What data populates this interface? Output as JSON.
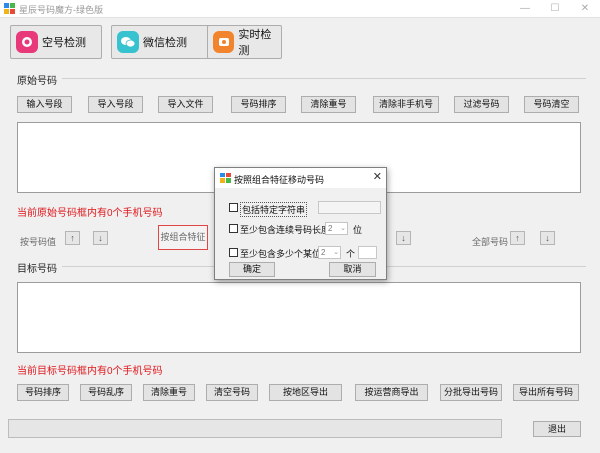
{
  "window": {
    "title": "星辰号码魔方-绿色版",
    "minimize": "—",
    "maximize": "☐",
    "close": "✕"
  },
  "top_buttons": [
    {
      "label": "空号检测",
      "color": "#e8397a"
    },
    {
      "label": "微信检测",
      "color": "#36c2cf"
    },
    {
      "label": "实时检测",
      "color": "#f2842d"
    }
  ],
  "source": {
    "section_label": "原始号码",
    "buttons": [
      "输入号段",
      "导入号段",
      "导入文件",
      "号码排序",
      "清除重号",
      "清除非手机号",
      "过滤号码",
      "号码清空"
    ],
    "count_note": "当前原始号码框内有0个手机号码"
  },
  "move_row": {
    "by_value_label": "按号码值",
    "up": "↑",
    "down": "↓",
    "by_feature_label": "按组合特征",
    "all_label": "全部号码"
  },
  "target": {
    "section_label": "目标号码",
    "count_note": "当前目标号码框内有0个手机号码",
    "buttons": [
      "号码排序",
      "号码乱序",
      "清除重号",
      "清空号码",
      "按地区导出",
      "按运营商导出",
      "分批导出号码",
      "导出所有号码"
    ]
  },
  "exit_label": "退出",
  "dialog": {
    "title": "按照组合特征移动号码",
    "close": "✕",
    "opt1": "包括特定字符串",
    "opt2": "至少包含连续号码长度为",
    "opt2_value": "2",
    "opt2_unit": "位",
    "opt3": "至少包含多少个某位数",
    "opt3_value": "2",
    "opt3_unit": "个",
    "ok": "确定",
    "cancel": "取消"
  }
}
